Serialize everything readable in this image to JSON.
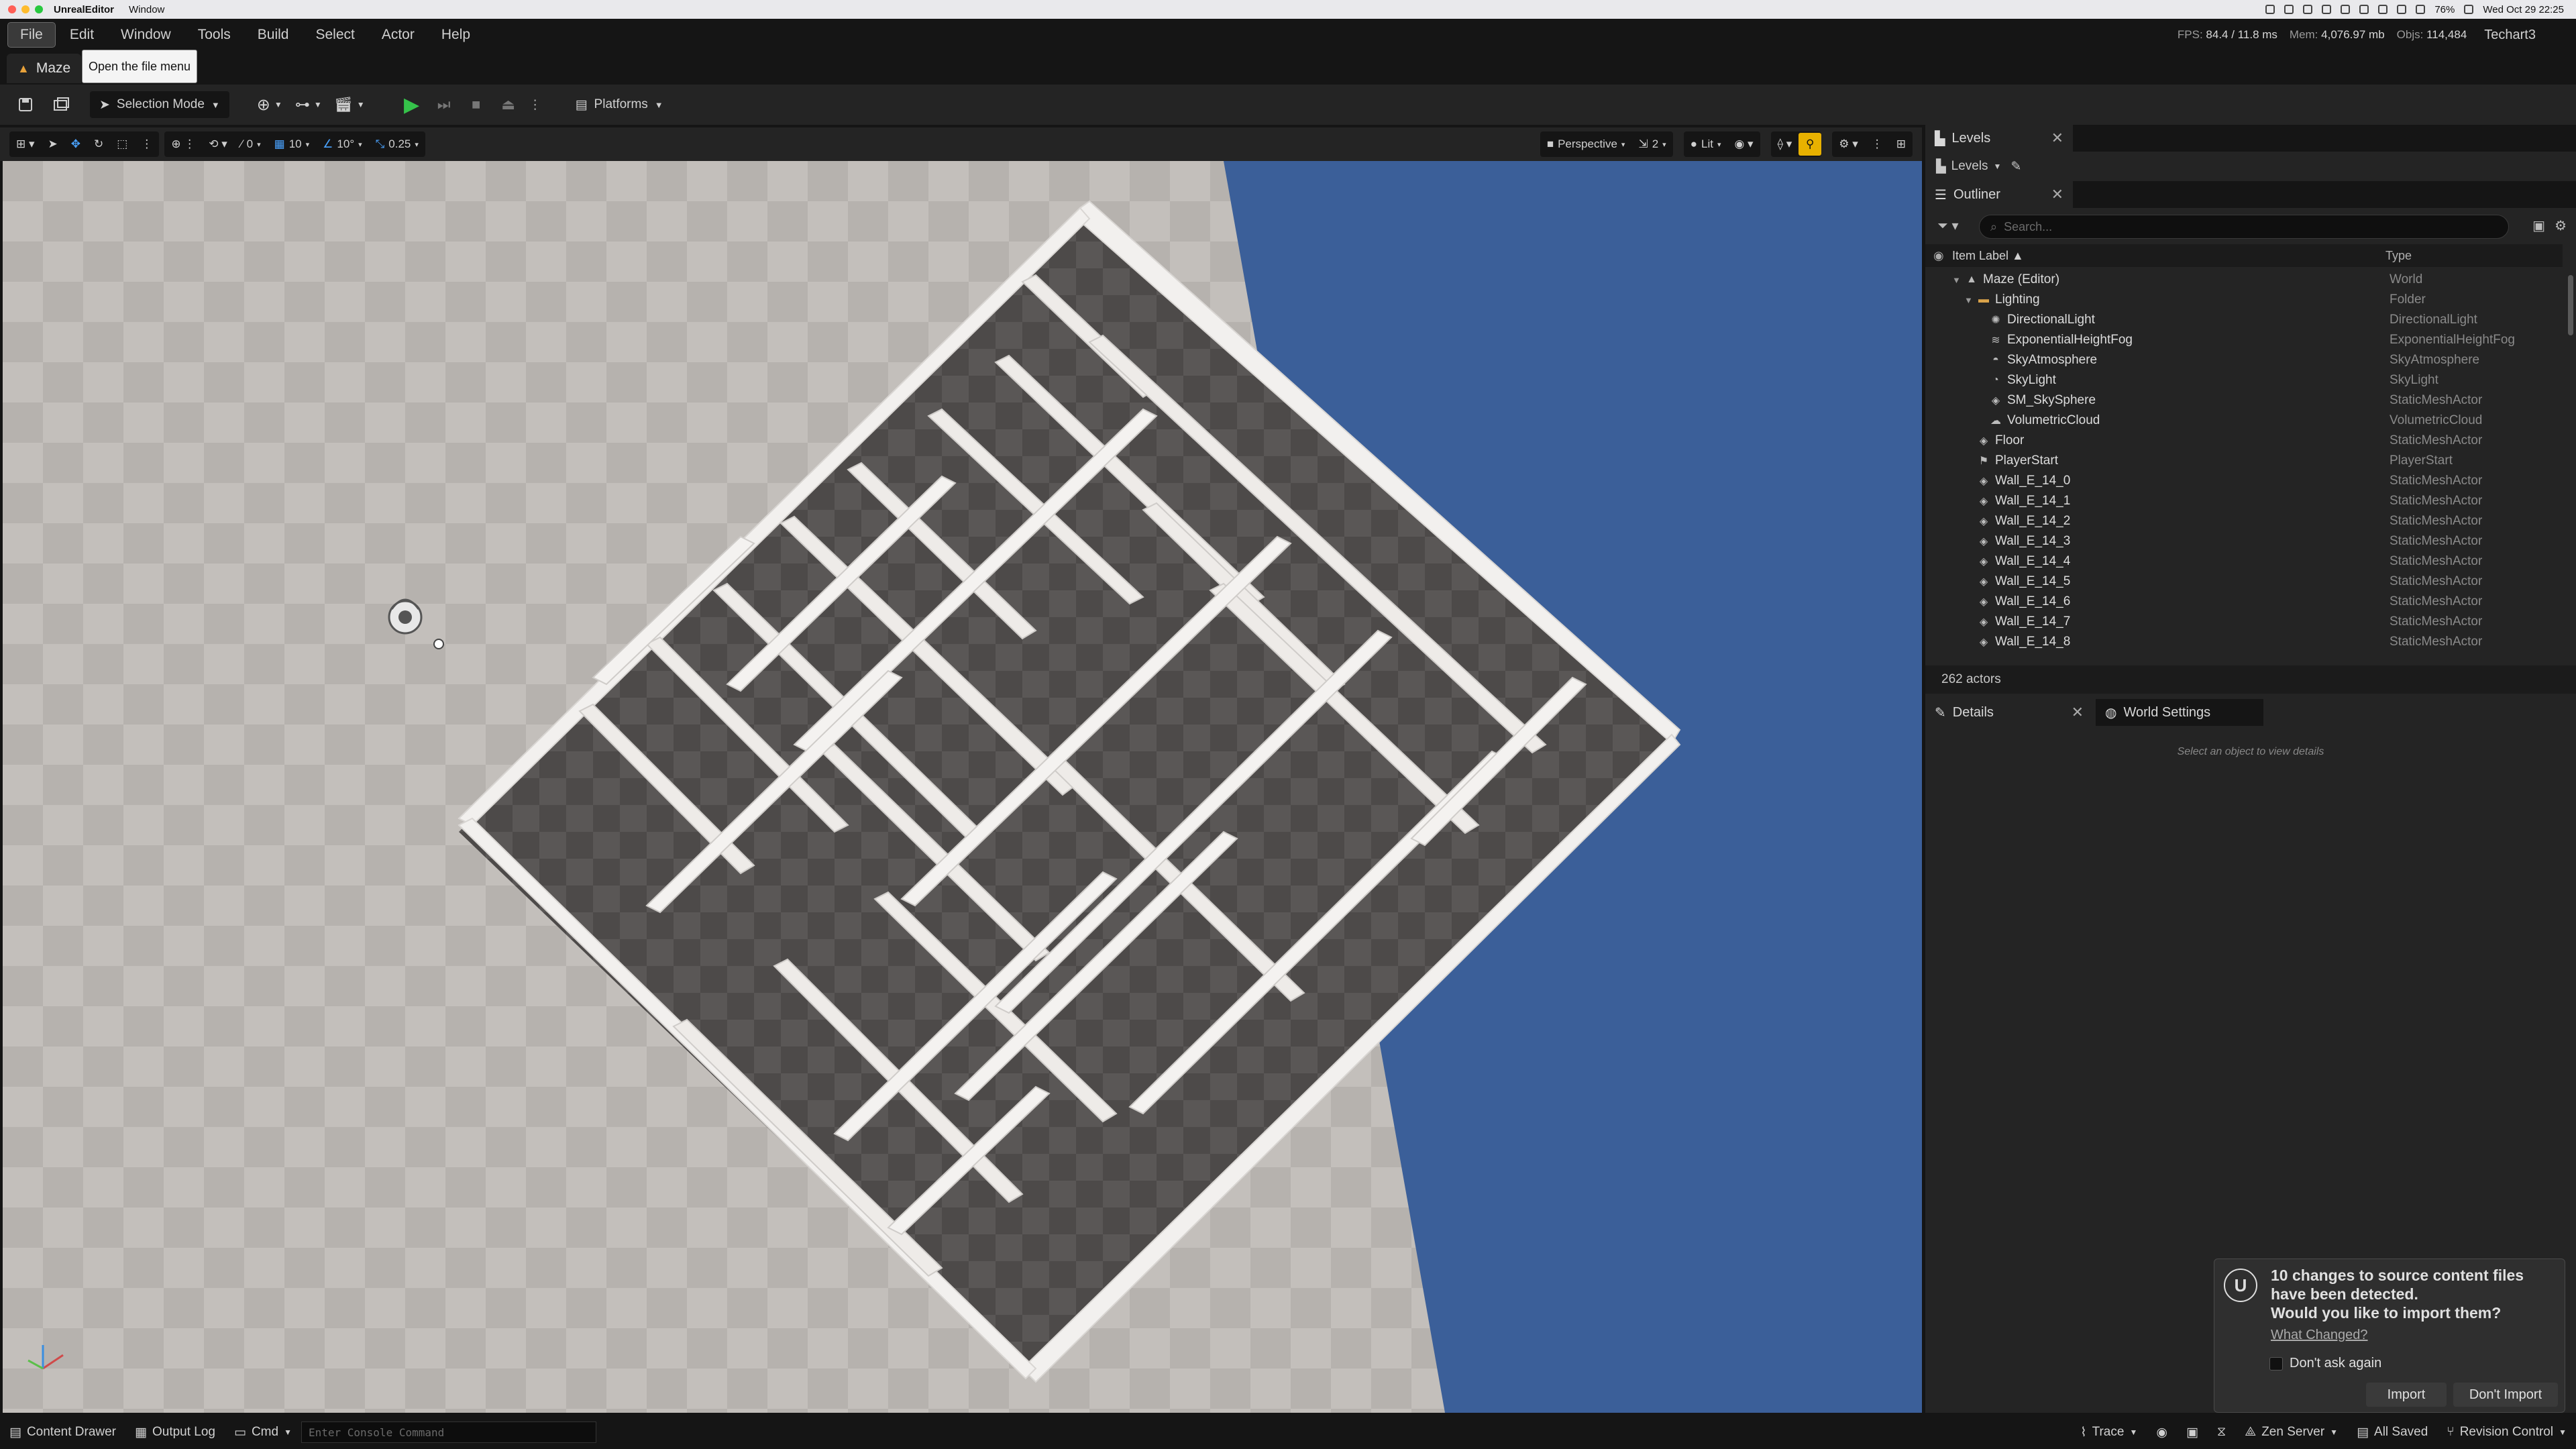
{
  "mac": {
    "app_name": "UnrealEditor",
    "window_menu": "Window",
    "clock": "Wed Oct 29  22:25",
    "battery": "76%"
  },
  "menubar": {
    "items": [
      "File",
      "Edit",
      "Window",
      "Tools",
      "Build",
      "Select",
      "Actor",
      "Help"
    ],
    "stats": {
      "fps_label": "FPS:",
      "fps_value": "84.4",
      "frame_ms": "/ 11.8 ms",
      "mem_label": "Mem:",
      "mem_value": "4,076.97 mb",
      "objs_label": "Objs:",
      "objs_value": "114,484"
    },
    "user": "Techart3"
  },
  "level_tab": {
    "label": "Maze"
  },
  "tooltip": "Open the file menu",
  "toolbar": {
    "selection_mode": "Selection Mode",
    "platforms": "Platforms"
  },
  "viewport_toolbar": {
    "translate_snap": "0",
    "grid_snap": "10",
    "rotation_snap": "10°",
    "scale_snap": "0.25",
    "view_mode": "Perspective",
    "camera_speed": "2",
    "lighting_mode": "Lit"
  },
  "levels_panel": {
    "tab": "Levels",
    "dropdown": "Levels"
  },
  "outliner": {
    "tab": "Outliner",
    "search_placeholder": "Search...",
    "col_label": "Item Label ▲",
    "col_type": "Type",
    "rows": [
      {
        "label": "Maze (Editor)",
        "type": "World",
        "depth": 0,
        "icon": "world-icon",
        "caret": "▼"
      },
      {
        "label": "Lighting",
        "type": "Folder",
        "depth": 1,
        "icon": "folder-icon",
        "caret": "▼"
      },
      {
        "label": "DirectionalLight",
        "type": "DirectionalLight",
        "depth": 2,
        "icon": "sun-icon",
        "caret": ""
      },
      {
        "label": "ExponentialHeightFog",
        "type": "ExponentialHeightFog",
        "depth": 2,
        "icon": "fog-icon",
        "caret": ""
      },
      {
        "label": "SkyAtmosphere",
        "type": "SkyAtmosphere",
        "depth": 2,
        "icon": "atmosphere-icon",
        "caret": ""
      },
      {
        "label": "SkyLight",
        "type": "SkyLight",
        "depth": 2,
        "icon": "skylight-icon",
        "caret": ""
      },
      {
        "label": "SM_SkySphere",
        "type": "StaticMeshActor",
        "depth": 2,
        "icon": "mesh-icon",
        "caret": ""
      },
      {
        "label": "VolumetricCloud",
        "type": "VolumetricCloud",
        "depth": 2,
        "icon": "cloud-icon",
        "caret": ""
      },
      {
        "label": "Floor",
        "type": "StaticMeshActor",
        "depth": 1,
        "icon": "mesh-icon",
        "caret": ""
      },
      {
        "label": "PlayerStart",
        "type": "PlayerStart",
        "depth": 1,
        "icon": "player-start-icon",
        "caret": ""
      },
      {
        "label": "Wall_E_14_0",
        "type": "StaticMeshActor",
        "depth": 1,
        "icon": "mesh-icon",
        "caret": ""
      },
      {
        "label": "Wall_E_14_1",
        "type": "StaticMeshActor",
        "depth": 1,
        "icon": "mesh-icon",
        "caret": ""
      },
      {
        "label": "Wall_E_14_2",
        "type": "StaticMeshActor",
        "depth": 1,
        "icon": "mesh-icon",
        "caret": ""
      },
      {
        "label": "Wall_E_14_3",
        "type": "StaticMeshActor",
        "depth": 1,
        "icon": "mesh-icon",
        "caret": ""
      },
      {
        "label": "Wall_E_14_4",
        "type": "StaticMeshActor",
        "depth": 1,
        "icon": "mesh-icon",
        "caret": ""
      },
      {
        "label": "Wall_E_14_5",
        "type": "StaticMeshActor",
        "depth": 1,
        "icon": "mesh-icon",
        "caret": ""
      },
      {
        "label": "Wall_E_14_6",
        "type": "StaticMeshActor",
        "depth": 1,
        "icon": "mesh-icon",
        "caret": ""
      },
      {
        "label": "Wall_E_14_7",
        "type": "StaticMeshActor",
        "depth": 1,
        "icon": "mesh-icon",
        "caret": ""
      },
      {
        "label": "Wall_E_14_8",
        "type": "StaticMeshActor",
        "depth": 1,
        "icon": "mesh-icon",
        "caret": ""
      }
    ],
    "actor_count": "262 actors"
  },
  "details": {
    "tab": "Details",
    "world_settings_tab": "World Settings",
    "empty_text": "Select an object to view details"
  },
  "toast": {
    "line1": "10 changes to source content files",
    "line2": "have been detected.",
    "line3": "Would you like to import them?",
    "what_changed": "What Changed?",
    "dont_ask": "Don't ask again",
    "import_button": "Import",
    "dont_import_button": "Don't Import"
  },
  "statusbar": {
    "content_drawer": "Content Drawer",
    "output_log": "Output Log",
    "cmd": "Cmd",
    "console_placeholder": "Enter Console Command",
    "trace": "Trace",
    "zen_server": "Zen Server",
    "all_saved": "All Saved",
    "revision_control": "Revision Control"
  },
  "colors": {
    "accent_snap": "#e8b100",
    "play_green": "#35c24a",
    "sky_blue": "#3b5f99"
  }
}
